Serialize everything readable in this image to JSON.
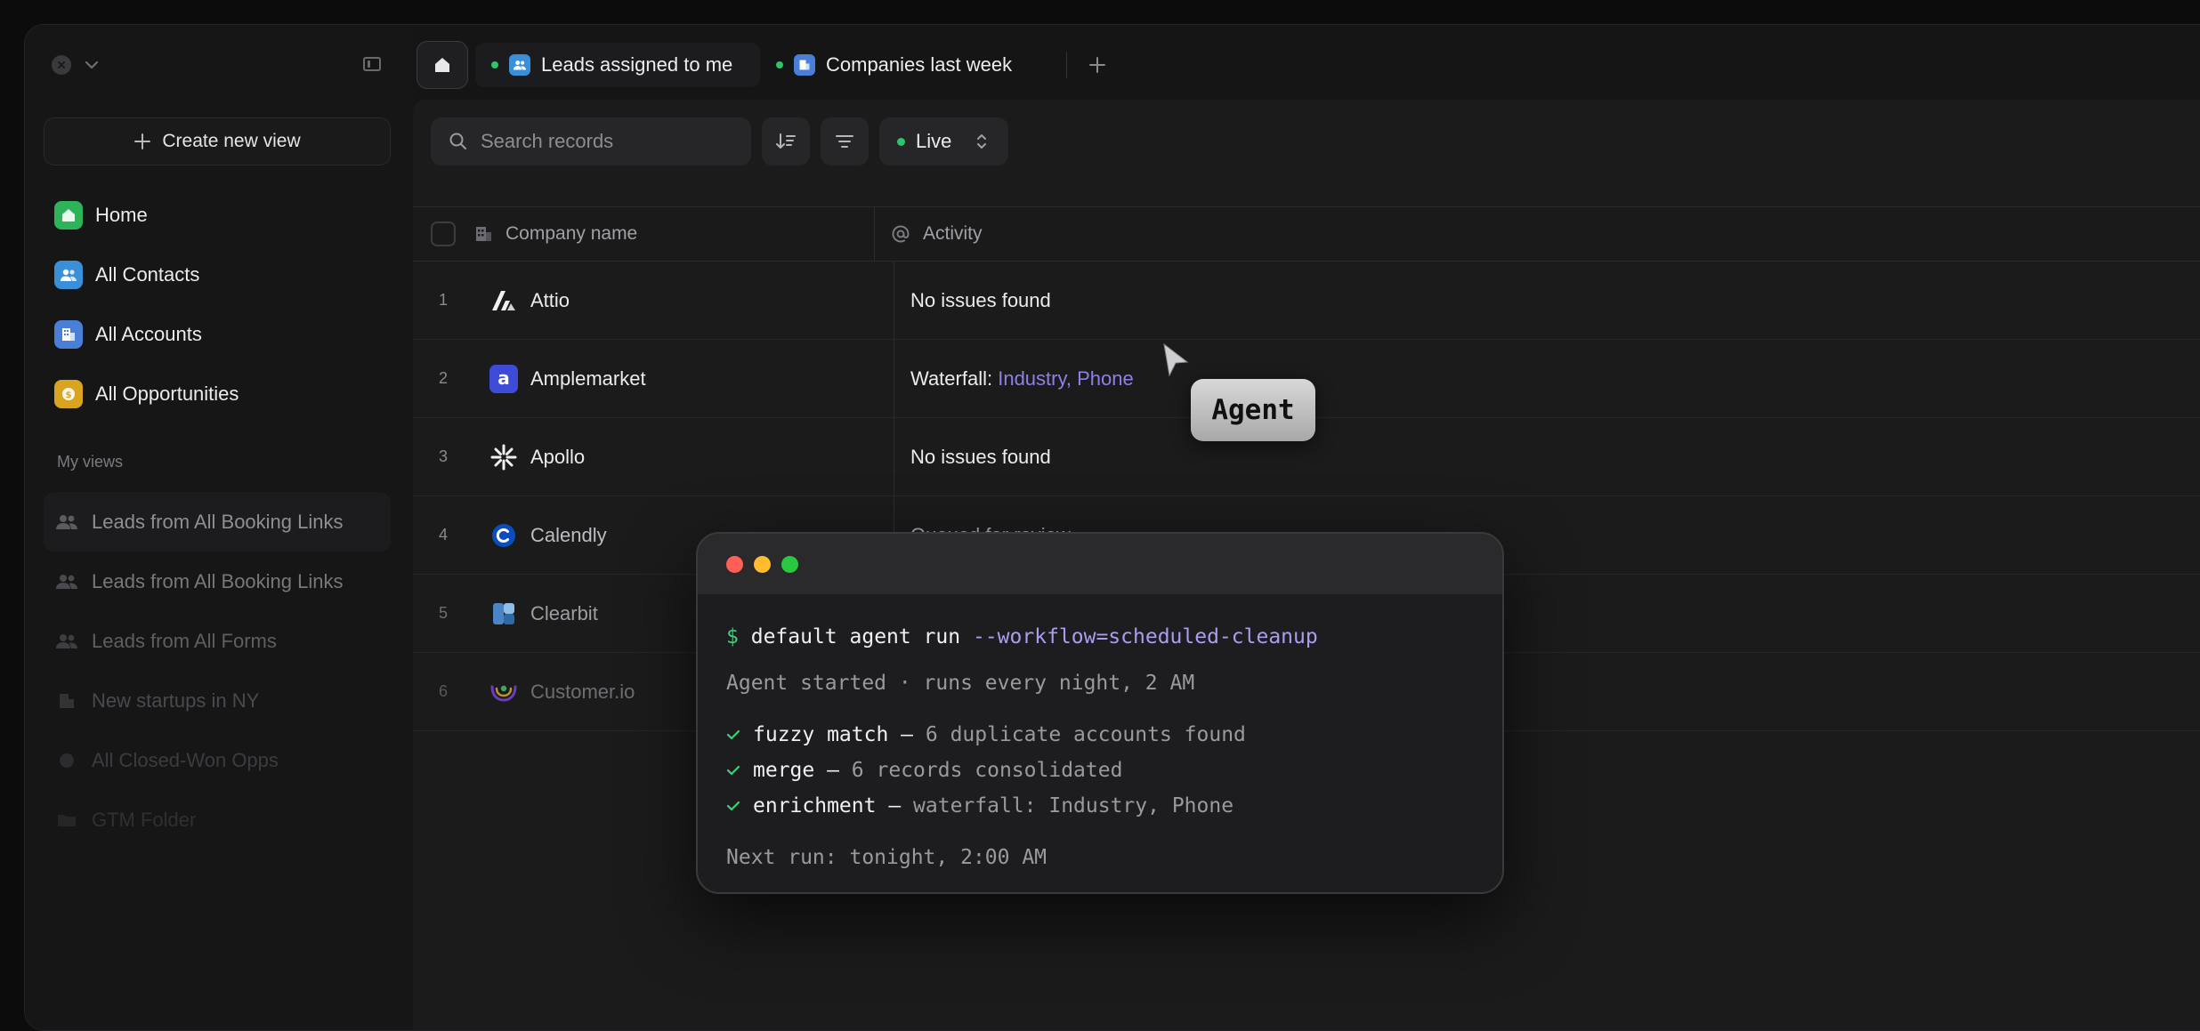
{
  "sidebar": {
    "create_label": "Create new view",
    "nav": [
      {
        "label": "Home",
        "icon": "home-icon",
        "color": "#2fb35a"
      },
      {
        "label": "All Contacts",
        "icon": "contacts-icon",
        "color": "#3a8fd9"
      },
      {
        "label": "All Accounts",
        "icon": "accounts-icon",
        "color": "#4a7fd8"
      },
      {
        "label": "All Opportunities",
        "icon": "opportunities-icon",
        "color": "#d9a520"
      }
    ],
    "views_label": "My views",
    "views": [
      {
        "label": "Leads from All Booking Links",
        "icon": "people-icon"
      },
      {
        "label": "Leads from All Booking Links",
        "icon": "people-icon"
      },
      {
        "label": "Leads from All Forms",
        "icon": "people-icon"
      },
      {
        "label": "New startups in NY",
        "icon": "building-icon"
      },
      {
        "label": "All Closed-Won Opps",
        "icon": "coin-icon"
      },
      {
        "label": "GTM Folder",
        "icon": "folder-icon"
      }
    ]
  },
  "tabs": [
    {
      "label": "Leads assigned to me",
      "icon": "contacts-icon"
    },
    {
      "label": "Companies last week",
      "icon": "accounts-icon"
    }
  ],
  "toolbar": {
    "search_placeholder": "Search records",
    "live_label": "Live"
  },
  "table": {
    "columns": {
      "name": "Company name",
      "activity": "Activity"
    },
    "rows": [
      {
        "num": "1",
        "name": "Attio",
        "activity": "No issues found"
      },
      {
        "num": "2",
        "name": "Amplemarket",
        "activity_prefix": "Waterfall: ",
        "activity_link": "Industry, Phone"
      },
      {
        "num": "3",
        "name": "Apollo",
        "activity": "No issues found"
      },
      {
        "num": "4",
        "name": "Calendly",
        "activity": "Queued for review"
      },
      {
        "num": "5",
        "name": "Clearbit"
      },
      {
        "num": "6",
        "name": "Customer.io"
      }
    ]
  },
  "agent_badge": "Agent",
  "terminal": {
    "prompt": "$",
    "command": "default agent run",
    "flag": "--workflow=scheduled-cleanup",
    "started": "Agent started · runs every night, 2 AM",
    "steps": [
      {
        "name": "fuzzy match",
        "sep": " — ",
        "detail": "6 duplicate accounts found"
      },
      {
        "name": "merge",
        "sep": " — ",
        "detail": "6 records consolidated"
      },
      {
        "name": "enrichment",
        "sep": " — ",
        "detail": "waterfall: Industry, Phone"
      }
    ],
    "next_run": "Next run: tonight, 2:00 AM"
  },
  "colors": {
    "accent_green": "#2ec46b",
    "link_purple": "#8d80ea",
    "traffic_red": "#ff5f57",
    "traffic_yellow": "#febc2e",
    "traffic_green": "#28c840"
  }
}
